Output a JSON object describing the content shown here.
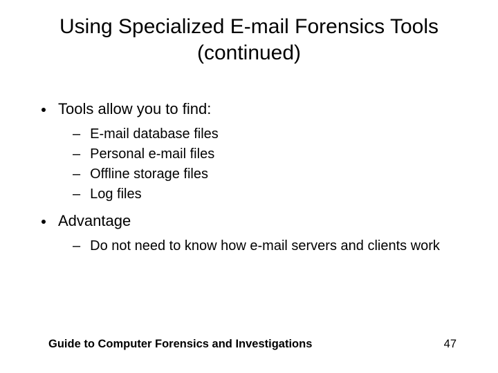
{
  "title": "Using Specialized E-mail Forensics Tools (continued)",
  "b1": "Tools allow you to find:",
  "b1s": {
    "a": "E-mail database files",
    "b": "Personal e-mail files",
    "c": "Offline storage files",
    "d": "Log files"
  },
  "b2": "Advantage",
  "b2s": {
    "a": "Do not need to know how e-mail servers and clients work"
  },
  "footer": {
    "title": "Guide to Computer Forensics and Investigations",
    "page": "47"
  },
  "dash": "–"
}
